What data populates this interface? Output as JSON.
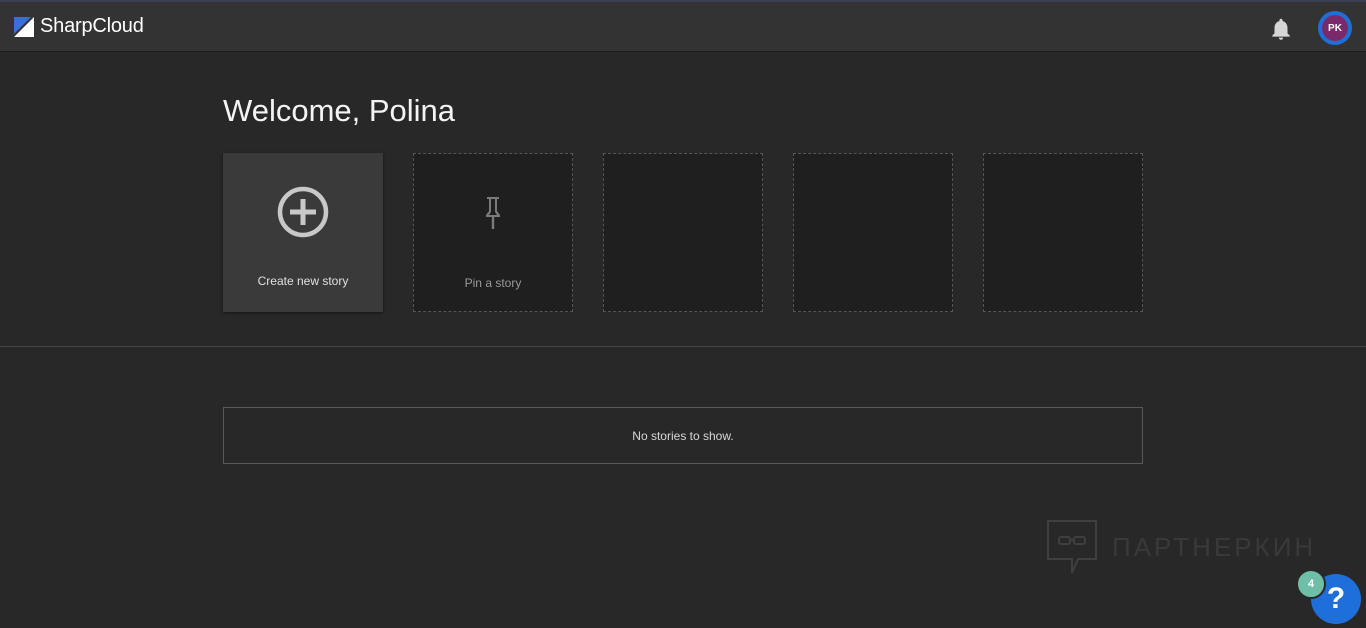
{
  "header": {
    "brand": "SharpCloud",
    "avatar_initials": "PK"
  },
  "welcome": {
    "title": "Welcome, Polina"
  },
  "cards": {
    "create_label": "Create new story",
    "pin_label": "Pin a story"
  },
  "stories": {
    "empty_message": "No stories to show."
  },
  "watermark": {
    "text": "ПАРТНЕРКИН"
  },
  "help": {
    "badge_count": "4",
    "label": "?"
  },
  "colors": {
    "background": "#282828",
    "topbar": "#333333",
    "accent": "#1e6fd9",
    "avatar": "#7a2a6b",
    "badge": "#6fbfa8"
  },
  "icons": [
    "logo-icon",
    "bell-icon",
    "plus-circle-icon",
    "pin-icon",
    "chat-icon",
    "help-icon"
  ]
}
